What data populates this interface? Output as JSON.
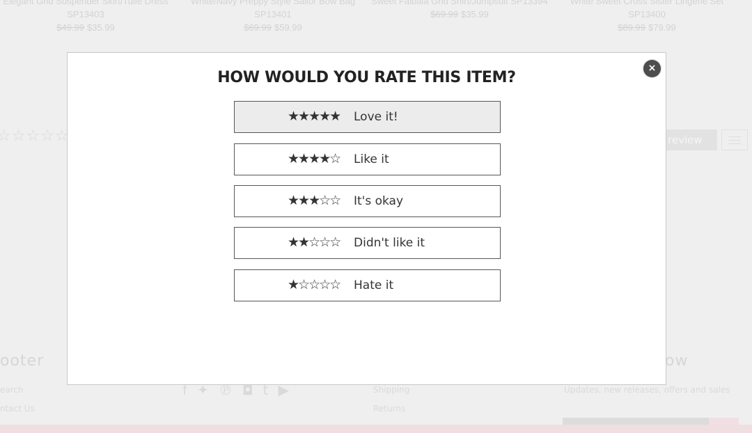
{
  "background": {
    "products": [
      {
        "name": "Elegant Grid Suspender Skirt/Tulle Dress SP13403",
        "old_price": "$49.99",
        "price": "$35.99"
      },
      {
        "name": "White/Navy Preppy Style Sailor Bow Bag SP13401",
        "old_price": "$69.99",
        "price": "$59.99"
      },
      {
        "name": "Sweet Falbala Grid Shirt/Jumpsuit SP13394",
        "old_price": "$69.99",
        "price": "$35.99"
      },
      {
        "name": "White Sweet Cross Sister Lingerie Set SP13400",
        "old_price": "$89.99",
        "price": "$79.99"
      }
    ],
    "empty_stars": "☆☆☆☆☆",
    "review_button": "review",
    "footer_heading_left": "ooter",
    "footer_heading_right": "ow",
    "footer_links_left": [
      "earch",
      "ntact Us"
    ],
    "footer_links_mid": [
      "Shipping",
      "Returns"
    ],
    "footer_note": "Updates, new releases, offers and sales",
    "social_icons": [
      "facebook-icon",
      "twitter-icon",
      "pinterest-icon",
      "instagram-icon",
      "tumblr-icon",
      "youtube-icon"
    ]
  },
  "modal": {
    "title": "HOW WOULD YOU RATE THIS ITEM?",
    "close_label": "×",
    "options": [
      {
        "stars": "★★★★★",
        "rating": 5,
        "label": "Love it!",
        "selected": true
      },
      {
        "stars": "★★★★☆",
        "rating": 4,
        "label": "Like it"
      },
      {
        "stars": "★★★☆☆",
        "rating": 3,
        "label": "It's okay"
      },
      {
        "stars": "★★☆☆☆",
        "rating": 2,
        "label": "Didn't like it"
      },
      {
        "stars": "★☆☆☆☆",
        "rating": 1,
        "label": "Hate it"
      }
    ]
  }
}
